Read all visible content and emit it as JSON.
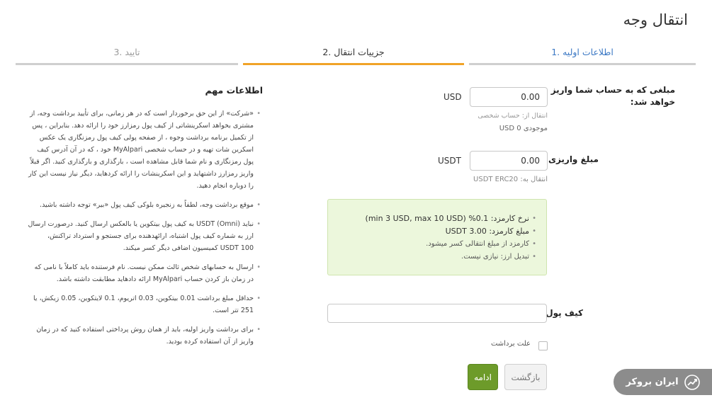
{
  "page_title": "انتقال وجه",
  "steps": [
    {
      "label": "1. اطلاعات اولیه"
    },
    {
      "label": "2. جزییات انتقال"
    },
    {
      "label": "3. تایید"
    }
  ],
  "form": {
    "amount_label": "مبلغی که به حساب شما واریز خواهد شد:",
    "amount_value": "0.00",
    "amount_currency": "USD",
    "transfer_from": "انتقال از: حساب شخصی",
    "balance": "موجودی 0 USD",
    "deposit_label": "مبلغ واریزی:",
    "deposit_value": "0.00",
    "deposit_currency": "USDT",
    "transfer_to": "انتقال به: USDT ERC20",
    "fees": [
      "نرخ کارمزد: 0.1% (min 3 USD, max 10 USD)",
      "مبلغ کارمزد: 3.00 USDT",
      "کارمزد از مبلغ انتقالی کسر میشود.",
      "تبدیل ارز: نیازی نیست."
    ],
    "wallet_label": "کیف پول",
    "wallet_value": "",
    "withdraw_reason_label": "علت برداشت",
    "back_button": "بازگشت",
    "continue_button": "ادامه"
  },
  "info": {
    "title": "اطلاعات مهم",
    "items": [
      "«شرکت» از این حق برخوردار است که در هر زمانی، برای تأیید برداشت وجه، از مشتری بخواهد اسکرینشاتی از کیف پول رمزارز خود را ارائه دهد. بنابراین ، پس از تکمیل برنامه برداشت وجوه ، از صفحه پولی کیف پول رمزنگاری یک عکس اسکرین شات تهیه و در حساب شخصی MyAlpari خود ، که در آن آدرس کیف پول رمزنگاری و نام شما قابل مشاهده است ، بارگذاری و بارگذاری کنید. اگر قبلاً واریز رمزارز داشتهاید و این اسکرینشات را ارائه کردهاید، دیگر نیاز نیست این کار را دوباره انجام دهید.",
      "موقع برداشت وجه، لطفاً به زنجیره بلوکی کیف پول «بیر» توجه داشته باشید.",
      "نباید USDT (Omni) به کیف پول بیتکوین یا بالعکس ارسال کنید. درصورت ارسال ارز به شماره کیف پول اشتباه، ارائهدهنده برای جستجو و استرداد تراکنش، USDT 100 کمیسیون اضافی دیگر کسر میکند.",
      "ارسال به حسابهای شخص ثالث ممکن نیست. نام فرستنده باید کاملاً با نامی که در زمان باز کردن حساب MyAlpari ارائه دادهاید مطابقت داشته باشد.",
      "حداقل مبلغ برداشت 0.01 بیتکوین، 0.03 اتریوم، 0.1 لایتکوین، 0.05 زیکش، یا 251 تتر است.",
      "برای برداشت واریز اولیه، باید از همان روش پرداختی استفاده کنید که در زمان واریز از آن استفاده کرده بودید."
    ]
  },
  "watermark": {
    "text": "ایران بروکر",
    "icon": "chart-arrow-icon"
  },
  "colors": {
    "active_step": "#f0a327",
    "link": "#3b78c4",
    "fee_bg": "#ecf7dc",
    "continue_bg": "#6d9b2a"
  }
}
